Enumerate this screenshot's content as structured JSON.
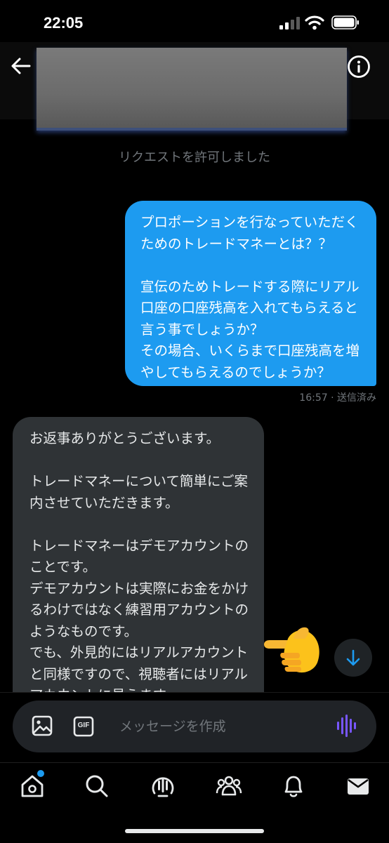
{
  "status_bar": {
    "time": "22:05"
  },
  "conversation": {
    "request_note": "リクエストを許可しました",
    "sent_message": {
      "text": "プロポーションを行なっていただくためのトレードマネーとは？？\n\n宣伝のためトレードする際にリアル口座の口座残高を入れてもらえると言う事でしょうか？\nその場合、いくらまで口座残高を増やしてもらえるのでしょうか？",
      "meta": "16:57 · 送信済み"
    },
    "received_message": {
      "text": "お返事ありがとうございます。\n\nトレードマネーについて簡単にご案内させていただきます。\n\nトレードマネーはデモアカウントのことです。\nデモアカウントは実際にお金をかけるわけではなく練習用アカウントのようなものです。\nでも、外見的にはリアルアカウントと同様ですので、視聴者にはリアルアカウントに見えます。"
    }
  },
  "composer": {
    "placeholder": "メッセージを作成",
    "gif_label": "GIF"
  },
  "colors": {
    "accent": "#1d9bf0",
    "received_bubble": "#2f3336",
    "muted_text": "#71767b",
    "voice_icon": "#7856ff"
  },
  "icons": {
    "header": [
      "back-arrow-icon",
      "info-icon"
    ],
    "composer": [
      "image-icon",
      "gif-icon",
      "voice-wave-icon"
    ],
    "nav": [
      "home-icon",
      "search-icon",
      "spaces-icon",
      "communities-icon",
      "bell-icon",
      "envelope-icon"
    ],
    "overlay": [
      "pointing-hand-emoji",
      "arrow-down-icon"
    ]
  }
}
